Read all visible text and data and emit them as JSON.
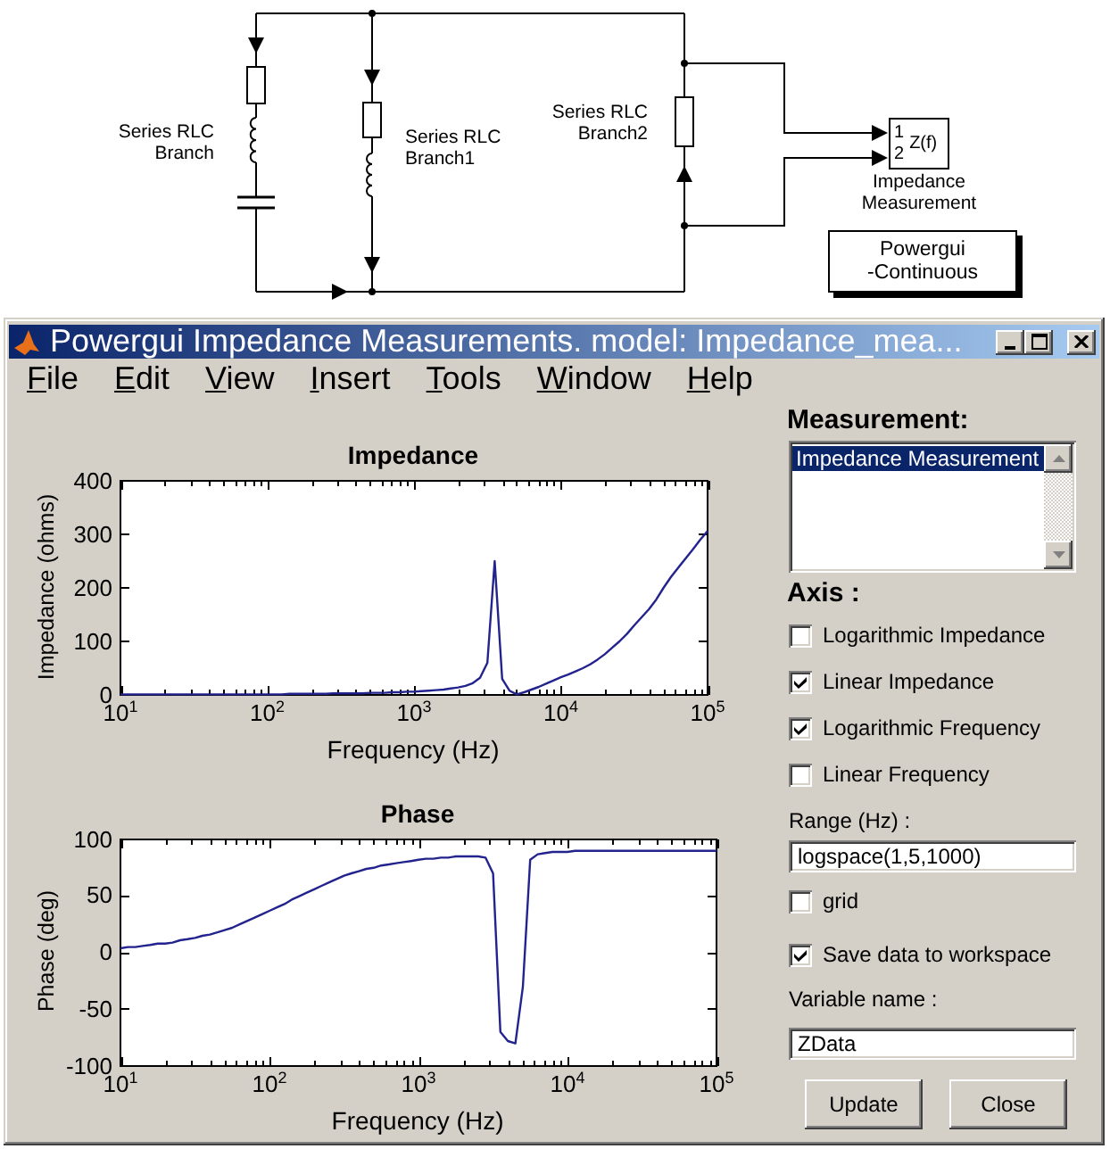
{
  "diagram": {
    "branches": [
      {
        "kind": "rlc",
        "label": "Series RLC Branch"
      },
      {
        "kind": "rl",
        "label": "Series RLC Branch1"
      },
      {
        "kind": "r",
        "label": "Series RLC Branch2"
      }
    ],
    "measurement_block": {
      "inputs": [
        "1",
        "2"
      ],
      "symbol": "Z(f)",
      "label": "Impedance Measurement"
    },
    "powergui_block": {
      "label": "Powergui -Continuous"
    }
  },
  "window": {
    "title": "Powergui Impedance Measurements. model: Impedance_mea..."
  },
  "menu": [
    "File",
    "Edit",
    "View",
    "Insert",
    "Tools",
    "Window",
    "Help"
  ],
  "plots": [
    {
      "chart_data": {
        "type": "line",
        "title": "Impedance",
        "xlabel": "Frequency (Hz)",
        "ylabel": "Impedance (ohms)",
        "categories": [
          "10$^{1}$",
          null,
          null,
          null,
          null,
          null,
          null,
          null,
          null,
          null,
          null,
          null,
          null,
          null,
          null,
          null,
          null,
          null,
          null,
          null,
          "10$^{2}$",
          null,
          null,
          null,
          null,
          null,
          null,
          null,
          null,
          null,
          null,
          null,
          null,
          null,
          null,
          null,
          null,
          null,
          null,
          null,
          "10$^{3}$",
          null,
          null,
          null,
          null,
          null,
          null,
          null,
          null,
          null,
          null,
          null,
          null,
          null,
          null,
          null,
          null,
          null,
          null,
          null,
          "10$^{4}$",
          null,
          null,
          null,
          null,
          null,
          null,
          null,
          null,
          null,
          null,
          null,
          null,
          null,
          null,
          null,
          null,
          null,
          null,
          null,
          "10$^{5}$"
        ],
        "values": [
          1,
          1,
          1,
          1,
          1,
          1,
          1,
          1,
          1,
          1,
          1,
          1,
          1,
          1,
          1,
          1,
          1,
          1,
          1,
          1,
          1,
          1,
          1,
          2,
          2,
          2,
          2,
          2,
          2,
          3,
          3,
          3,
          3,
          3,
          4,
          4,
          4,
          5,
          5,
          6,
          6,
          7,
          8,
          9,
          10,
          12,
          14,
          17,
          22,
          32,
          60,
          250,
          30,
          8,
          1,
          5,
          10,
          15,
          21,
          27,
          33,
          38,
          44,
          50,
          57,
          66,
          76,
          88,
          100,
          114,
          130,
          145,
          160,
          178,
          200,
          220,
          238,
          255,
          272,
          290,
          306
        ],
        "ylim": [
          0,
          400
        ],
        "yticks": [
          0,
          100,
          200,
          300,
          400
        ]
      }
    },
    {
      "chart_data": {
        "type": "line",
        "title": "Phase",
        "xlabel": "Frequency (Hz)",
        "ylabel": "Phase (deg)",
        "categories": [
          "10$^{1}$",
          null,
          null,
          null,
          null,
          null,
          null,
          null,
          null,
          null,
          null,
          null,
          null,
          null,
          null,
          null,
          null,
          null,
          null,
          null,
          "10$^{2}$",
          null,
          null,
          null,
          null,
          null,
          null,
          null,
          null,
          null,
          null,
          null,
          null,
          null,
          null,
          null,
          null,
          null,
          null,
          null,
          "10$^{3}$",
          null,
          null,
          null,
          null,
          null,
          null,
          null,
          null,
          null,
          null,
          null,
          null,
          null,
          null,
          null,
          null,
          null,
          null,
          null,
          "10$^{4}$",
          null,
          null,
          null,
          null,
          null,
          null,
          null,
          null,
          null,
          null,
          null,
          null,
          null,
          null,
          null,
          null,
          null,
          null,
          null,
          "10$^{5}$"
        ],
        "values": [
          4,
          5,
          5,
          6,
          7,
          8,
          8,
          9,
          11,
          12,
          13,
          15,
          16,
          18,
          20,
          22,
          25,
          28,
          31,
          34,
          37,
          40,
          43,
          47,
          50,
          53,
          56,
          59,
          62,
          65,
          68,
          70,
          72,
          74,
          75,
          77,
          78,
          79,
          80,
          81,
          82,
          83,
          83,
          84,
          84,
          85,
          85,
          85,
          85,
          84,
          70,
          -70,
          -78,
          -80,
          -30,
          82,
          87,
          88,
          89,
          89,
          89,
          90,
          90,
          90,
          90,
          90,
          90,
          90,
          90,
          90,
          90,
          90,
          90,
          90,
          90,
          90,
          90,
          90,
          90,
          90,
          90
        ],
        "ylim": [
          -100,
          100
        ],
        "yticks": [
          -100,
          -50,
          0,
          50,
          100
        ]
      }
    }
  ],
  "panel": {
    "measurement_label": "Measurement:",
    "measurements": [
      {
        "label": "Impedance Measurement",
        "selected": true
      }
    ],
    "axis_label": "Axis :",
    "axis_options": [
      {
        "label": "Logarithmic Impedance",
        "checked": false
      },
      {
        "label": "Linear Impedance",
        "checked": true
      },
      {
        "label": "Logarithmic Frequency",
        "checked": true
      },
      {
        "label": "Linear Frequency",
        "checked": false
      }
    ],
    "range_label": "Range (Hz) :",
    "range_value": "logspace(1,5,1000)",
    "grid": {
      "label": "grid",
      "checked": false
    },
    "save_data": {
      "label": "Save data to workspace",
      "checked": true
    },
    "variable_label": "Variable name :",
    "variable_value": "ZData",
    "buttons": [
      "Update",
      "Close"
    ]
  }
}
